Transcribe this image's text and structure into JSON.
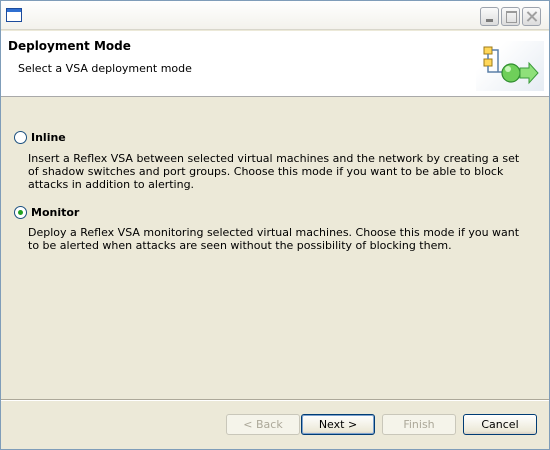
{
  "window": {
    "title": ""
  },
  "header": {
    "title": "Deployment Mode",
    "subtitle": "Select a VSA deployment mode"
  },
  "options": [
    {
      "label": "Inline",
      "selected": false,
      "description": "Insert a Reflex VSA between selected virtual machines and the network by creating a set of shadow switches and port groups.  Choose this mode if you want to be able to block attacks in addition to alerting."
    },
    {
      "label": "Monitor",
      "selected": true,
      "description": "Deploy a Reflex VSA monitoring selected virtual machines.  Choose this mode if you want to be alerted when attacks are seen without the possibility of blocking them."
    }
  ],
  "buttons": {
    "back": "< Back",
    "next": "Next >",
    "finish": "Finish",
    "cancel": "Cancel"
  },
  "colors": {
    "dialog_bg": "#ece9d8",
    "header_bg": "#ffffff",
    "radio_dot": "#21a121",
    "button_border": "#003c74"
  },
  "icons": {
    "window": "app-window-icon",
    "header": "deployment-flow-icon"
  }
}
